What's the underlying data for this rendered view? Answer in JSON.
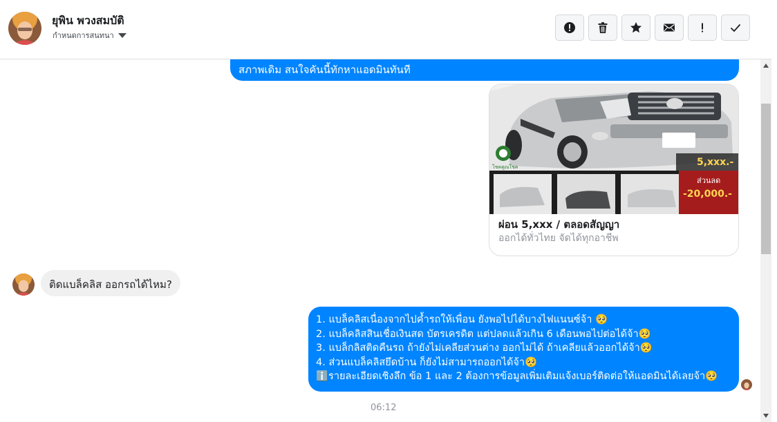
{
  "header": {
    "contact_name": "ยุพิน พวงสมบัติ",
    "assign_label": "กำหนดการสนทนา",
    "toolbar": {
      "report_icon": "alert-circle-icon",
      "delete_icon": "trash-icon",
      "star_icon": "star-icon",
      "mail_icon": "envelope-icon",
      "spam_icon": "exclamation-icon",
      "done_icon": "checkmark-icon"
    }
  },
  "thread": {
    "outgoing_top_text": "สภาพเดิม สนใจคันนี้ทักหาแอดมินทันที",
    "card": {
      "title": "ผ่อน 5,xxx / ตลอดสัญญา",
      "subtitle": "ออกได้ทั่วไทย จัดได้ทุกอาชีพ",
      "image_texts": {
        "price": "5,xxx.-",
        "discount_label": "ส่วนลด",
        "discount": "-20,000.-",
        "brand": "โชคคูณโชค"
      }
    },
    "incoming_message": "ติดแบล็คลิส ออกรถได้ไหม?",
    "outgoing_lines": [
      "1. แบล็คลิสเนื่องจากไปค้ำรถให้เพื่อน ยังพอไปได้บางไฟแนนซ์จ้า 🥺",
      "2. แบล็คลิสสินเชื่อเงินสด บัตรเครดิต แต่ปลดแล้วเกิน 6 เดือนพอไปต่อได้จ้า🥺",
      "3. แบล็กลิสติดคืนรถ ถ้ายังไม่เคลียส่วนต่าง ออกไม่ได้ ถ้าเคลียแล้วออกได้จ้า🥺",
      "4. ส่วนแบล็คลิสยึดบ้าน ก็ยังไม่สามารถออกได้จ้า🥺",
      "ℹ️รายละเอียดเชิงลึก ข้อ 1 และ 2 ต้องการข้อมูลเพิ่มเติมแจ้งเบอร์ติดต่อให้แอดมินได้เลยจ้า🥺"
    ],
    "timestamp": "06:12"
  }
}
